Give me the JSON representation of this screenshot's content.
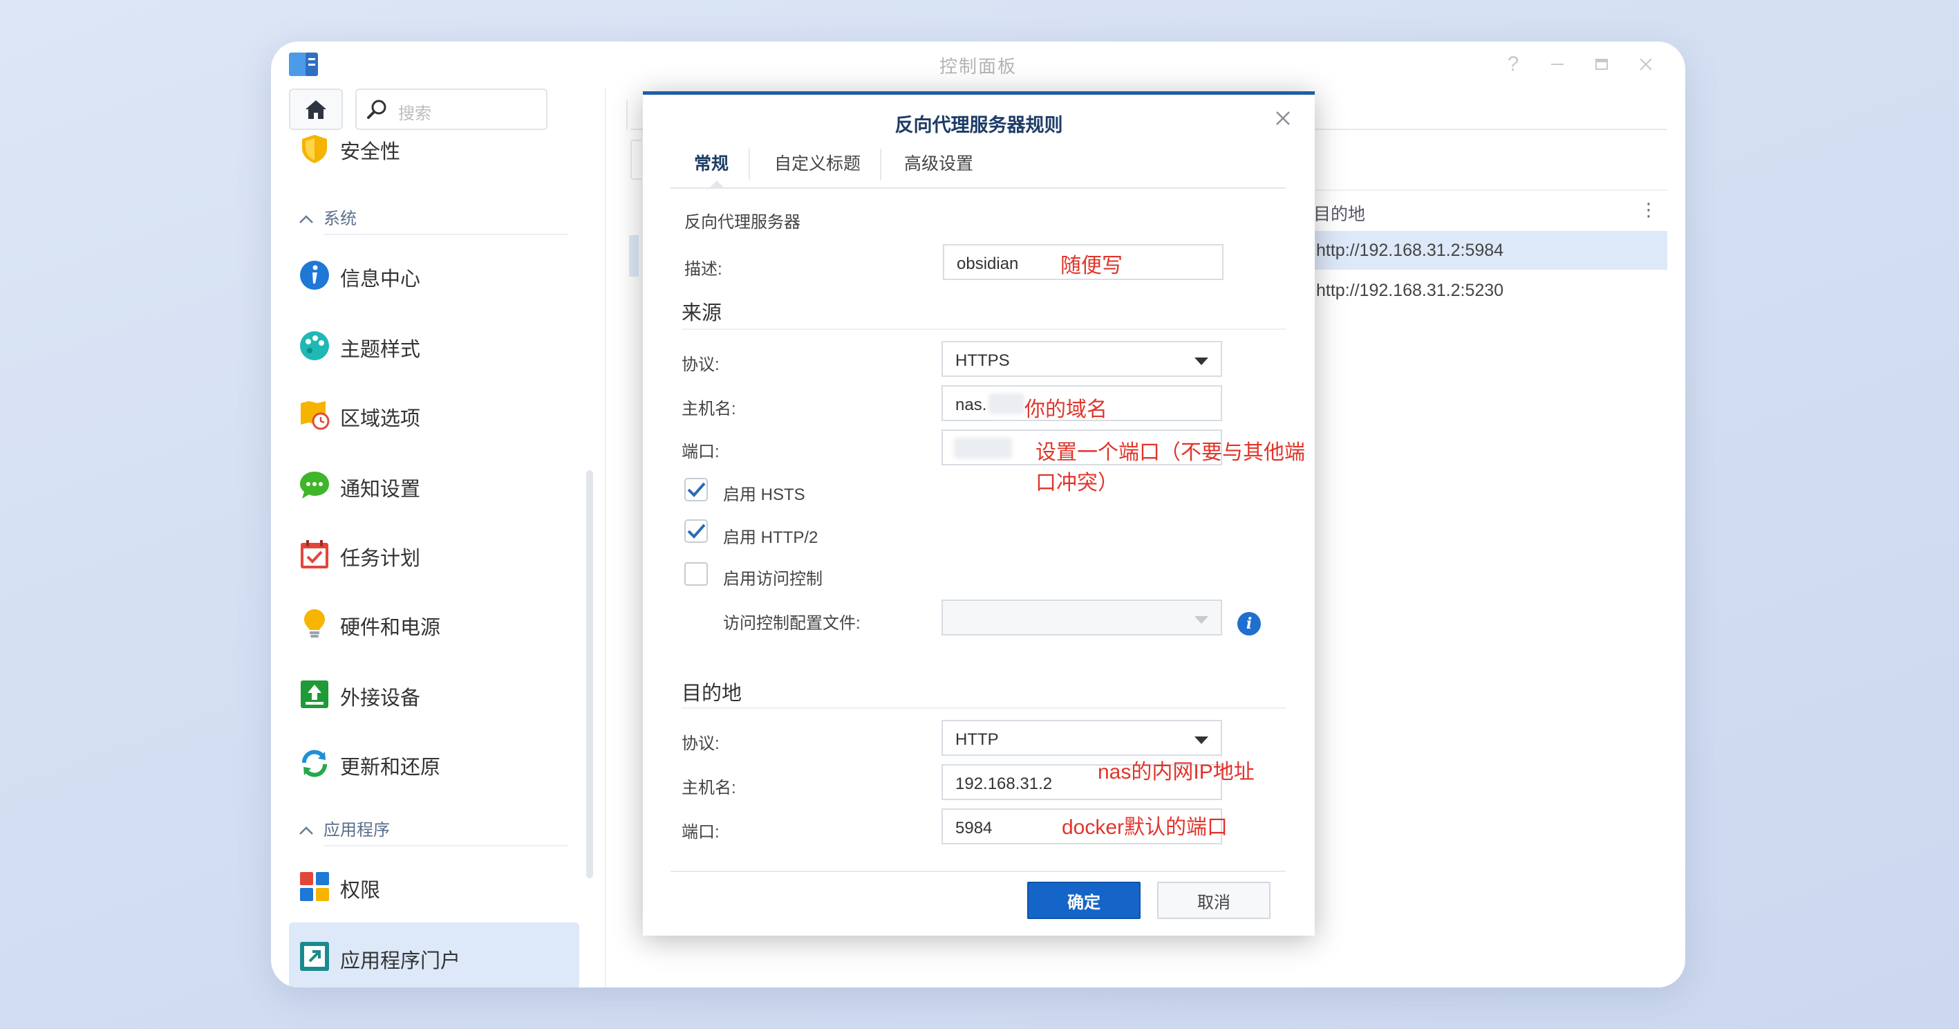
{
  "window": {
    "title": "控制面板"
  },
  "sidebar": {
    "search_placeholder": "搜索",
    "top_item": "安全性",
    "section_system": "系统",
    "system_items": [
      "信息中心",
      "主题样式",
      "区域选项",
      "通知设置",
      "任务计划",
      "硬件和电源",
      "外接设备",
      "更新和还原"
    ],
    "section_apps": "应用程序",
    "app_items": [
      "权限",
      "应用程序门户"
    ],
    "selected_item": "应用程序门户"
  },
  "background_table": {
    "column_header": "目的地",
    "rows": [
      "http://192.168.31.2:5984",
      "http://192.168.31.2:5230"
    ]
  },
  "dialog": {
    "title": "反向代理服务器规则",
    "tabs": [
      "常规",
      "自定义标题",
      "高级设置"
    ],
    "active_tab": "常规",
    "group_label": "反向代理服务器",
    "description_label": "描述:",
    "description_value": "obsidian",
    "source": {
      "title": "来源",
      "protocol_label": "协议:",
      "protocol_value": "HTTPS",
      "hostname_label": "主机名:",
      "hostname_value": "nas.",
      "port_label": "端口:",
      "port_value": ""
    },
    "checkboxes": [
      {
        "label": "启用 HSTS",
        "checked": true
      },
      {
        "label": "启用 HTTP/2",
        "checked": true
      },
      {
        "label": "启用访问控制",
        "checked": false
      }
    ],
    "access_profile_label": "访问控制配置文件:",
    "destination": {
      "title": "目的地",
      "protocol_label": "协议:",
      "protocol_value": "HTTP",
      "hostname_label": "主机名:",
      "hostname_value": "192.168.31.2",
      "port_label": "端口:",
      "port_value": "5984"
    },
    "ok_label": "确定",
    "cancel_label": "取消"
  },
  "annotations": {
    "description": "随便写",
    "domain": "你的域名",
    "port": "设置一个端口（不要与其他端口冲突）",
    "nas_ip": "nas的内网IP地址",
    "docker_port": "docker默认的端口"
  },
  "colors": {
    "accent": "#1565c8",
    "annotation": "#e0352b",
    "selected_bg": "#dde8f8"
  }
}
